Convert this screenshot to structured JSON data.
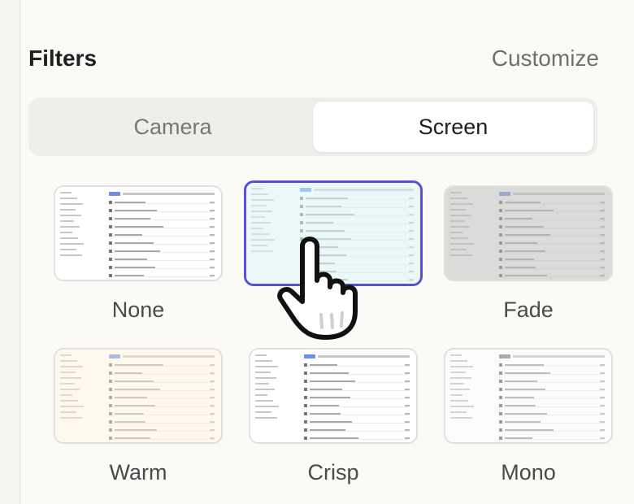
{
  "header": {
    "title": "Filters",
    "customize_label": "Customize"
  },
  "source_tabs": [
    {
      "label": "Camera",
      "active": false
    },
    {
      "label": "Screen",
      "active": true
    }
  ],
  "filters": [
    {
      "label": "None",
      "selected": false,
      "tint": "#ffffff",
      "tint_opacity": 0
    },
    {
      "label": "",
      "selected": true,
      "tint": "#d7f3f3",
      "tint_opacity": 0.55
    },
    {
      "label": "Fade",
      "selected": false,
      "tint": "#bdbdbb",
      "tint_opacity": 0.55
    },
    {
      "label": "Warm",
      "selected": false,
      "tint": "#fff1d8",
      "tint_opacity": 0.45
    },
    {
      "label": "Crisp",
      "selected": false,
      "tint": "#ffffff",
      "tint_opacity": 0
    },
    {
      "label": "Mono",
      "selected": false,
      "tint": "#f2f2f2",
      "tint_opacity": 0.3
    }
  ],
  "colors": {
    "accent": "#5a4fd6"
  },
  "cursor": {
    "icon": "hand-pointer-icon"
  }
}
